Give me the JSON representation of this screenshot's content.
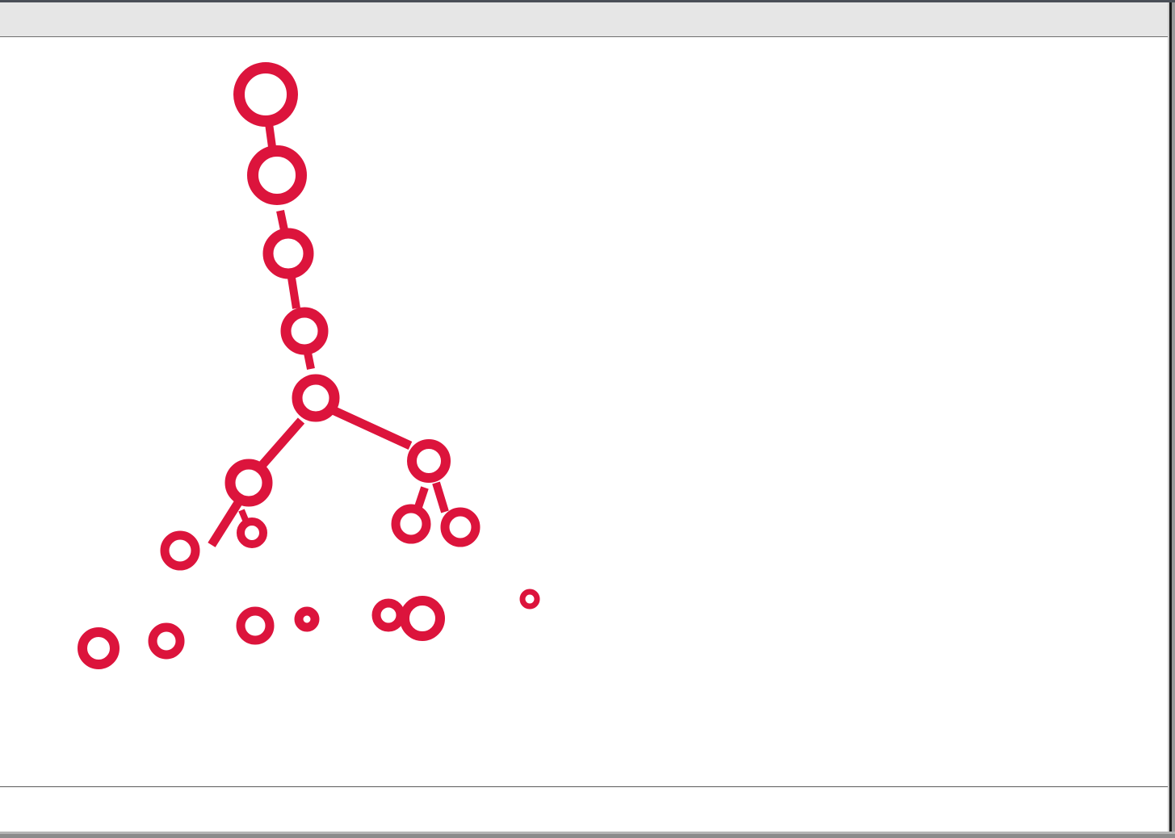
{
  "window": {
    "title": "",
    "status": ""
  },
  "colors": {
    "stroke": "#dc143c",
    "background": "#ffffff",
    "title_bar": "#e6e6e6"
  }
}
